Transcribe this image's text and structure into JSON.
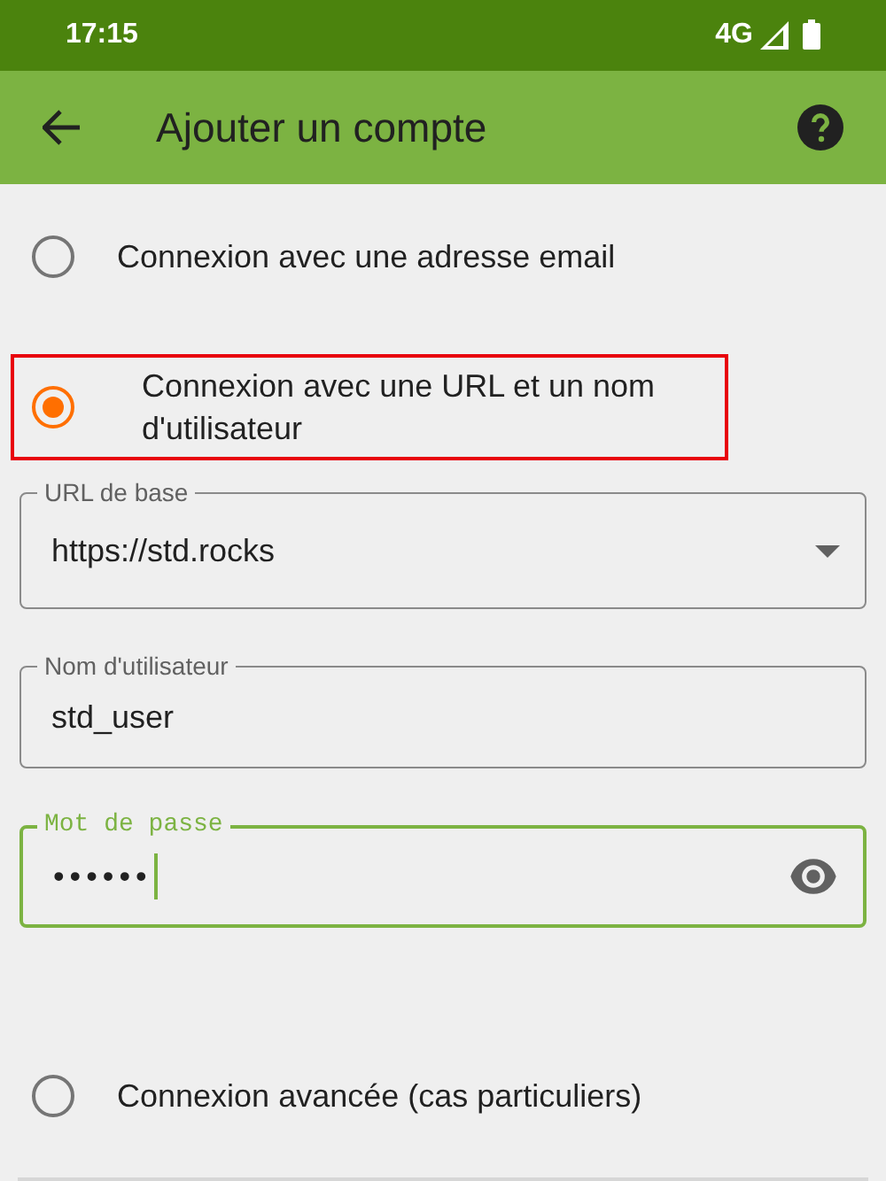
{
  "status_bar": {
    "time": "17:15",
    "network": "4G"
  },
  "app_bar": {
    "title": "Ajouter un compte"
  },
  "options_top": [
    {
      "label": "Connexion avec une adresse email",
      "selected": false,
      "highlighted": false
    },
    {
      "label": "Connexion avec une URL et un nom d'utilisateur",
      "selected": true,
      "highlighted": true
    }
  ],
  "fields": [
    {
      "kind": "dropdown",
      "label": "URL de base",
      "value": "https://std.rocks",
      "focused": false
    },
    {
      "kind": "text",
      "label": "Nom d'utilisateur",
      "value": "std_user",
      "focused": false
    },
    {
      "kind": "password",
      "label": "Mot de passe",
      "value": "••••••",
      "focused": true
    }
  ],
  "options_bottom": [
    {
      "label": "Connexion avancée (cas particuliers)",
      "selected": false,
      "highlighted": false
    }
  ]
}
